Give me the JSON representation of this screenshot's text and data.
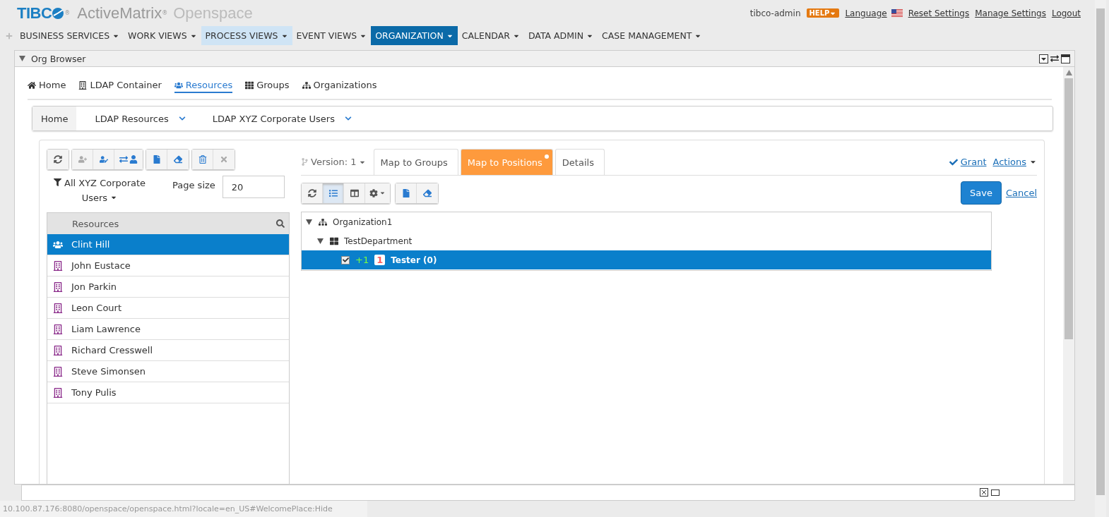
{
  "header": {
    "brand": "TIBC",
    "brand_mark": "®",
    "product": "ActiveMatrix",
    "product_mark": "®",
    "app": "Openspace",
    "user": "tibco-admin",
    "help": "HELP",
    "links": [
      {
        "label": "Language",
        "flag": true
      },
      {
        "label": "Reset Settings",
        "flag": false
      },
      {
        "label": "Manage Settings",
        "flag": false
      },
      {
        "label": "Logout",
        "flag": false
      }
    ]
  },
  "menu": [
    {
      "label": "BUSINESS SERVICES",
      "selected": false,
      "hovered": false
    },
    {
      "label": "WORK VIEWS",
      "selected": false,
      "hovered": false
    },
    {
      "label": "PROCESS VIEWS",
      "selected": false,
      "hovered": true
    },
    {
      "label": "EVENT VIEWS",
      "selected": false,
      "hovered": false
    },
    {
      "label": "ORGANIZATION",
      "selected": true,
      "hovered": false
    },
    {
      "label": "CALENDAR",
      "selected": false,
      "hovered": false
    },
    {
      "label": "DATA ADMIN",
      "selected": false,
      "hovered": false
    },
    {
      "label": "CASE MANAGEMENT",
      "selected": false,
      "hovered": false
    }
  ],
  "panel": {
    "title": "Org Browser"
  },
  "nav_tabs": [
    {
      "label": "Home",
      "kind": "home",
      "selected": false
    },
    {
      "label": "LDAP Container",
      "kind": "container",
      "selected": false
    },
    {
      "label": "Resources",
      "kind": "resources",
      "selected": true
    },
    {
      "label": "Groups",
      "kind": "groups",
      "selected": false
    },
    {
      "label": "Organizations",
      "kind": "organizations",
      "selected": false
    }
  ],
  "breadcrumb": [
    {
      "label": "Home",
      "selected": true,
      "dropdown": false
    },
    {
      "label": "LDAP Resources",
      "selected": false,
      "dropdown": true
    },
    {
      "label": "LDAP XYZ Corporate Users",
      "selected": false,
      "dropdown": true
    }
  ],
  "left_toolbar": [
    [
      {
        "kind": "refresh",
        "disabled": false
      }
    ],
    [
      {
        "kind": "add",
        "disabled": true
      },
      {
        "kind": "edit",
        "disabled": false
      },
      {
        "kind": "move",
        "disabled": false
      }
    ],
    [
      {
        "kind": "export",
        "disabled": false
      },
      {
        "kind": "clear",
        "disabled": false
      }
    ],
    [
      {
        "kind": "delete",
        "disabled": false
      },
      {
        "kind": "cancel",
        "disabled": true
      }
    ]
  ],
  "filter": {
    "label": "All XYZ Corporate Users",
    "page_size_label": "Page size",
    "page_size": "20"
  },
  "resources": {
    "header": "Resources",
    "items": [
      {
        "name": "Clint Hill",
        "kind": "group",
        "selected": true
      },
      {
        "name": "John Eustace",
        "kind": "person",
        "selected": false
      },
      {
        "name": "Jon Parkin",
        "kind": "person",
        "selected": false
      },
      {
        "name": "Leon Court",
        "kind": "person",
        "selected": false
      },
      {
        "name": "Liam Lawrence",
        "kind": "person",
        "selected": false
      },
      {
        "name": "Richard Cresswell",
        "kind": "person",
        "selected": false
      },
      {
        "name": "Steve Simonsen",
        "kind": "person",
        "selected": false
      },
      {
        "name": "Tony Pulis",
        "kind": "person",
        "selected": false
      }
    ]
  },
  "detail": {
    "version": "Version: 1",
    "tabs": [
      {
        "label": "Map to Groups",
        "selected": false,
        "modified": false
      },
      {
        "label": "Map to Positions",
        "selected": true,
        "modified": true
      },
      {
        "label": "Details",
        "selected": false,
        "modified": false
      }
    ],
    "grant": "Grant",
    "actions": "Actions",
    "save": "Save",
    "cancel": "Cancel",
    "toolbar": [
      [
        {
          "kind": "refresh",
          "selected": false
        },
        {
          "kind": "list",
          "selected": true
        },
        {
          "kind": "columns",
          "selected": false
        },
        {
          "kind": "settings",
          "selected": false
        }
      ],
      [
        {
          "kind": "export",
          "selected": false
        },
        {
          "kind": "clear",
          "selected": false
        }
      ]
    ],
    "tree": [
      {
        "label": "Organization1",
        "kind": "organization",
        "expanded": true,
        "children": [
          {
            "label": "TestDepartment",
            "kind": "unit",
            "expanded": true,
            "children": [
              {
                "label": "Tester (0)",
                "checked": true,
                "selected": true,
                "added": "+1",
                "count": "1"
              }
            ]
          }
        ]
      }
    ]
  },
  "status_url": "10.100.87.176:8080/openspace/openspace.html?locale=en_US#WelcomePlace:Hide"
}
